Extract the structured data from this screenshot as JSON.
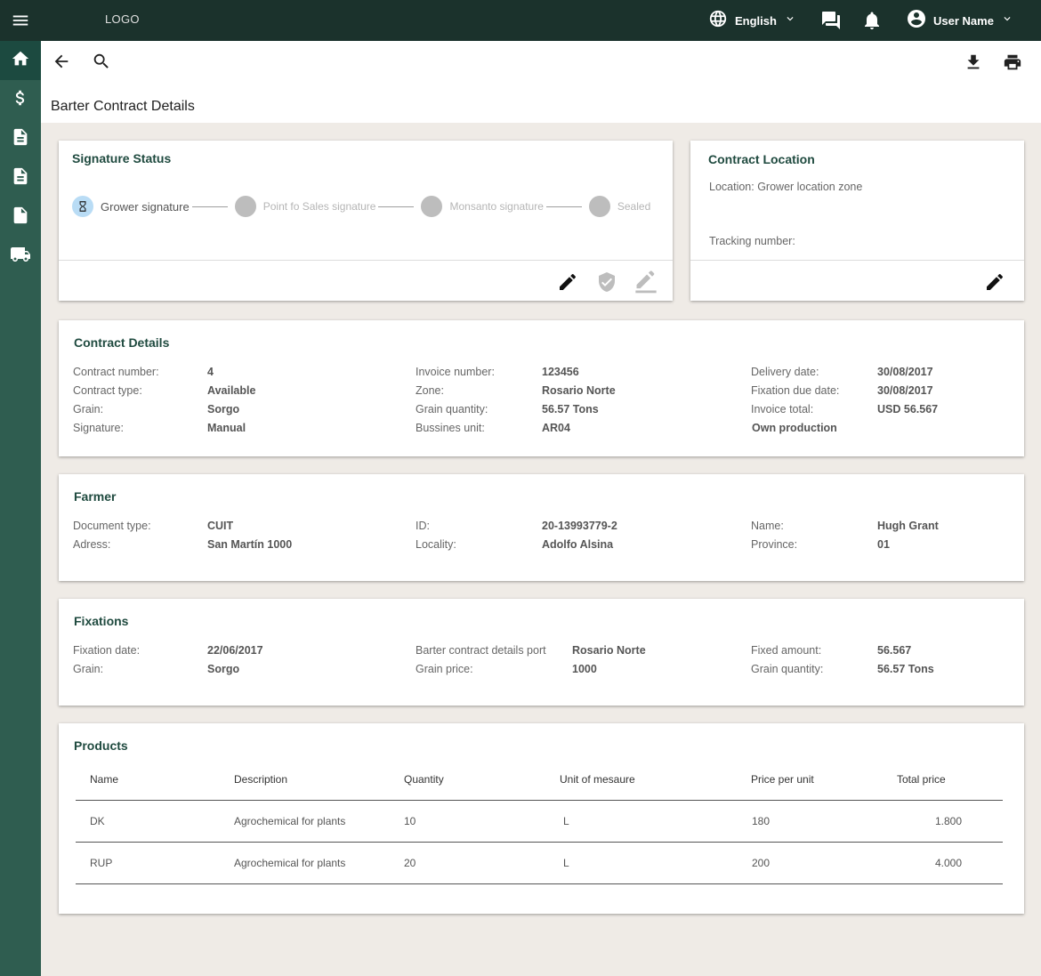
{
  "header": {
    "logo": "LOGO",
    "language": "English",
    "user_name": "User Name"
  },
  "sidebar": {
    "items": [
      {
        "icon": "home-icon",
        "active": true
      },
      {
        "icon": "dollar-icon",
        "active": false
      },
      {
        "icon": "document-icon",
        "active": false
      },
      {
        "icon": "document-icon",
        "active": false
      },
      {
        "icon": "file-icon",
        "active": false
      },
      {
        "icon": "truck-icon",
        "active": false
      }
    ]
  },
  "page": {
    "title": "Barter Contract Details"
  },
  "signature_status": {
    "title": "Signature Status",
    "steps": [
      {
        "label": "Grower signature",
        "state": "current"
      },
      {
        "label": "Point fo Sales signature",
        "state": "pending"
      },
      {
        "label": "Monsanto signature",
        "state": "pending"
      },
      {
        "label": "Sealed",
        "state": "pending"
      }
    ]
  },
  "contract_location": {
    "title": "Contract Location",
    "location": "Location: Grower location zone",
    "tracking": "Tracking number:"
  },
  "contract_details": {
    "title": "Contract Details",
    "columns": [
      [
        {
          "label": "Contract number:",
          "value": "4"
        },
        {
          "label": "Contract type:",
          "value": "Available"
        },
        {
          "label": "Grain:",
          "value": "Sorgo"
        },
        {
          "label": "Signature:",
          "value": "Manual"
        }
      ],
      [
        {
          "label": "Invoice number:",
          "value": "123456"
        },
        {
          "label": "Zone:",
          "value": "Rosario Norte"
        },
        {
          "label": "Grain quantity:",
          "value": "56.57 Tons"
        },
        {
          "label": "Bussines unit:",
          "value": "AR04"
        }
      ],
      [
        {
          "label": "Delivery date:",
          "value": "30/08/2017"
        },
        {
          "label": "Fixation due date:",
          "value": "30/08/2017"
        },
        {
          "label": "Invoice total:",
          "value": "USD 56.567"
        },
        {
          "label": "",
          "value": "Own production"
        }
      ]
    ]
  },
  "farmer": {
    "title": "Farmer",
    "columns": [
      [
        {
          "label": "Document type:",
          "value": "CUIT"
        },
        {
          "label": "Adress:",
          "value": "San Martín 1000"
        }
      ],
      [
        {
          "label": "ID:",
          "value": "20-13993779-2"
        },
        {
          "label": "Locality:",
          "value": "Adolfo Alsina"
        }
      ],
      [
        {
          "label": "Name:",
          "value": "Hugh Grant"
        },
        {
          "label": "Province:",
          "value": "01"
        }
      ]
    ]
  },
  "fixations": {
    "title": "Fixations",
    "columns": [
      [
        {
          "label": "Fixation date:",
          "value": "22/06/2017"
        },
        {
          "label": "Grain:",
          "value": "Sorgo"
        }
      ],
      [
        {
          "label": "Barter contract details port",
          "value": "Rosario Norte"
        },
        {
          "label": "Grain price:",
          "value": "1000"
        }
      ],
      [
        {
          "label": "Fixed amount:",
          "value": "56.567"
        },
        {
          "label": "Grain quantity:",
          "value": "56.57 Tons"
        }
      ]
    ]
  },
  "products": {
    "title": "Products",
    "headers": [
      "Name",
      "Description",
      "Quantity",
      "Unit of mesaure",
      "Price per unit",
      "Total price"
    ],
    "rows": [
      [
        "DK",
        "Agrochemical for plants",
        "10",
        "L",
        "180",
        "1.800"
      ],
      [
        "RUP",
        "Agrochemical for plants",
        "20",
        "L",
        "200",
        "4.000"
      ]
    ]
  },
  "colors": {
    "header_bg": "#1b322c",
    "sidebar_bg": "#2f5d50",
    "accent_text": "#1f4a3f",
    "page_bg": "#efebe6"
  }
}
